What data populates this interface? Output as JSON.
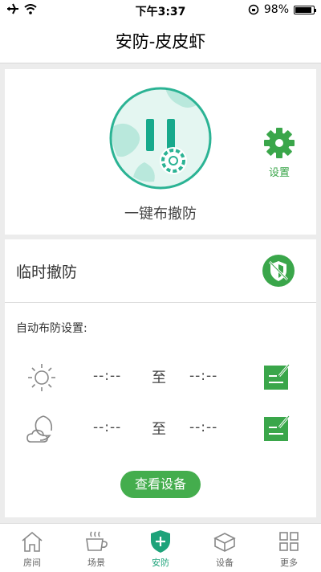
{
  "status_bar": {
    "time": "下午3:37",
    "battery": "98%"
  },
  "nav": {
    "title": "安防-皮皮虾"
  },
  "arm": {
    "label": "一键布撤防"
  },
  "setting": {
    "label": "设置"
  },
  "temp_disarm": {
    "label": "临时撤防"
  },
  "auto": {
    "title": "自动布防设置:",
    "rows": [
      {
        "start": "--:--",
        "to": "至",
        "end": "--:--"
      },
      {
        "start": "--:--",
        "to": "至",
        "end": "--:--"
      }
    ]
  },
  "view_button": {
    "label": "查看设备"
  },
  "tabs": [
    {
      "label": "房间"
    },
    {
      "label": "场景"
    },
    {
      "label": "安防"
    },
    {
      "label": "设备"
    },
    {
      "label": "更多"
    }
  ],
  "colors": {
    "green": "#44ad4d",
    "teal": "#1ea37a"
  }
}
